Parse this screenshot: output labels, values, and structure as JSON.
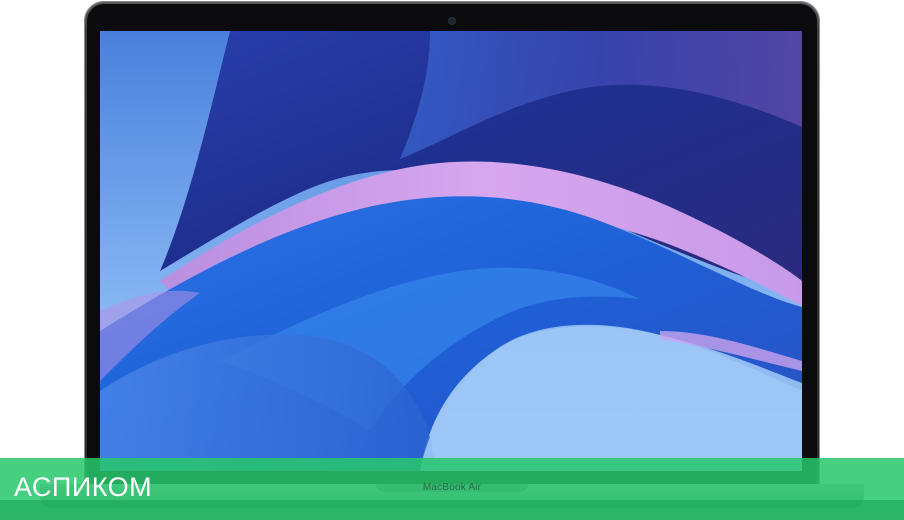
{
  "brand": {
    "name": "АСПИКОМ"
  },
  "device": {
    "model_label": "MacBook Air"
  },
  "colors": {
    "brand_band": "#28c76c",
    "screen_blue": "#3f76d8",
    "wave_dark": "#1c2f8c",
    "wave_pink": "#c79ae8"
  },
  "icons": [
    "camera-icon"
  ]
}
